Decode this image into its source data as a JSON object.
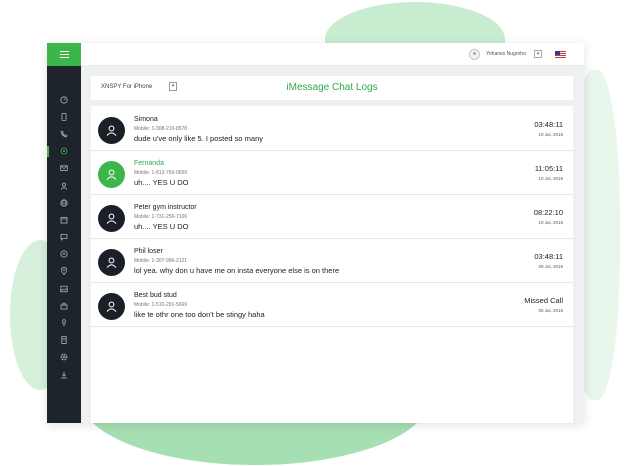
{
  "topbar": {
    "user_name": "Yohanes Nugroho",
    "caret": "▾"
  },
  "header": {
    "device": "XNSPY For iPhone",
    "device_caret": "▾",
    "title": "iMessage Chat Logs"
  },
  "sidebar": {
    "items": [
      "dashboard-icon",
      "phone-device-icon",
      "call-icon",
      "chat-icon",
      "email-icon",
      "contacts-icon",
      "browser-icon",
      "calendar-icon",
      "message-icon",
      "upload-icon",
      "location-icon",
      "photos-icon",
      "apps-icon",
      "microphone-icon",
      "device-icon",
      "settings-icon",
      "download-icon"
    ],
    "active_index": 3
  },
  "chats": [
    {
      "name": "Simona",
      "mobile": "Mobile: 1-308-210-8578",
      "message": "dude u've only like 5. I posted so many",
      "time": "03:48:11",
      "date": "10 Jul, 2016",
      "highlight": false
    },
    {
      "name": "Fernanda",
      "mobile": "Mobile: 1-813-769-0659",
      "message": "uh.... YES U DO",
      "time": "11:05:11",
      "date": "10 Jul, 2016",
      "highlight": true
    },
    {
      "name": "Peter gym instructor",
      "mobile": "Mobile: 1-731-256-7106",
      "message": "uh.... YES U DO",
      "time": "08:22:10",
      "date": "10 Jul, 2016",
      "highlight": false
    },
    {
      "name": "Phil loser",
      "mobile": "Mobile: 1-307-996-2121",
      "message": "lol yea. why don u have me on insta everyone else is on there",
      "time": "03:48:11",
      "date": "09 Jul, 2016",
      "highlight": false
    },
    {
      "name": "Best bud stud",
      "mobile": "Mobile: 1-510-201-5669",
      "message": "like te othr one too don't be stingy haha",
      "time": "Missed Call",
      "date": "08 Jul, 2016",
      "highlight": false
    }
  ],
  "colors": {
    "accent": "#3cb54a",
    "sidebar": "#1e242c",
    "avatar": "#1b2028"
  }
}
